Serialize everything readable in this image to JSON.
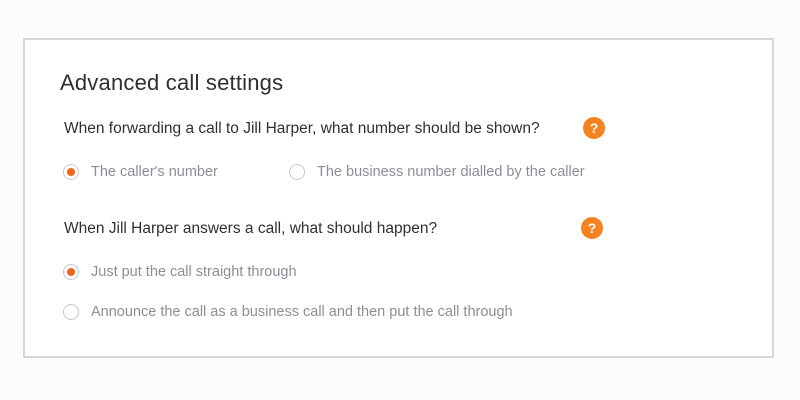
{
  "title": "Advanced call settings",
  "accent_color": "#f58220",
  "questions": [
    {
      "text": "When forwarding a call to Jill Harper, what number should be shown?",
      "help_icon": "?",
      "options": [
        {
          "label": "The caller's number",
          "selected": true
        },
        {
          "label": "The business number dialled by the caller",
          "selected": false
        }
      ]
    },
    {
      "text": "When Jill Harper answers a call, what should happen?",
      "help_icon": "?",
      "options": [
        {
          "label": "Just put the call straight through",
          "selected": true
        },
        {
          "label": "Announce the call as a business call and then put the call through",
          "selected": false
        }
      ]
    }
  ]
}
